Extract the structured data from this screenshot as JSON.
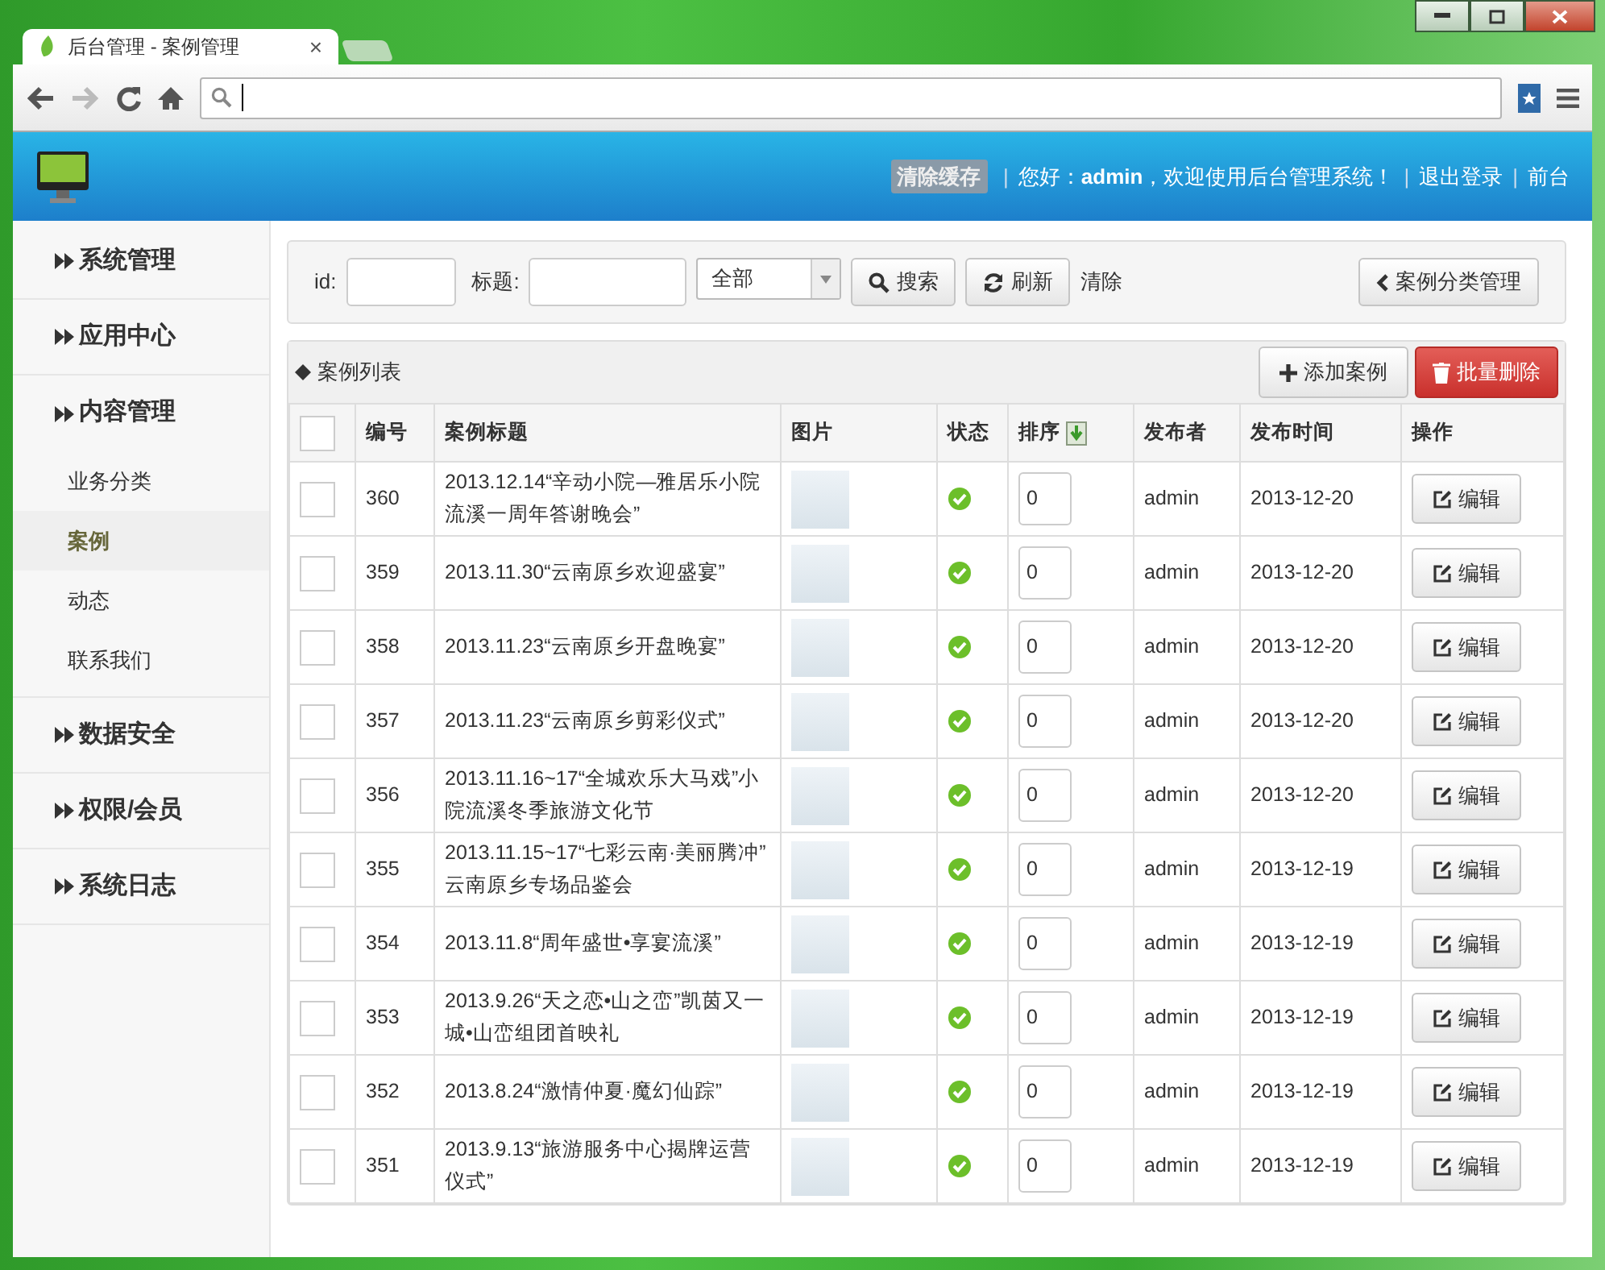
{
  "browser": {
    "tab_title": "后台管理 - 案例管理",
    "tab_close": "×"
  },
  "header": {
    "clear_cache": "清除缓存",
    "items": [
      {
        "separator": "|",
        "text": "您好：**admin**，欢迎使用后台管理系统！"
      },
      {
        "separator": "|",
        "text": "退出登录"
      },
      {
        "separator": "|",
        "text": "前台"
      }
    ]
  },
  "sidebar": {
    "groups": [
      {
        "label": "系统管理",
        "expanded": false
      },
      {
        "label": "应用中心",
        "expanded": false
      },
      {
        "label": "内容管理",
        "expanded": true,
        "children": [
          {
            "label": "业务分类",
            "selected": false
          },
          {
            "label": "案例",
            "selected": true
          },
          {
            "label": "动态",
            "selected": false
          },
          {
            "label": "联系我们",
            "selected": false
          }
        ]
      },
      {
        "label": "数据安全",
        "expanded": false
      },
      {
        "label": "权限/会员",
        "expanded": false
      },
      {
        "label": "系统日志",
        "expanded": false
      }
    ]
  },
  "filter": {
    "id_label": "id:",
    "title_label": "标题:",
    "select_value": "全部",
    "search": "搜索",
    "refresh": "刷新",
    "clear": "清除",
    "category_button": "案例分类管理"
  },
  "list": {
    "title": "案例列表",
    "add_button": "添加案例",
    "delete_button": "批量删除",
    "header_checked": false,
    "columns": [
      "编号",
      "案例标题",
      "图片",
      "状态",
      "排序",
      "发布者",
      "发布时间",
      "操作"
    ],
    "rows": [
      {
        "checked": false,
        "id": "360",
        "title": "2013.12.14“辛动小院—雅居乐小院流溪一周年答谢晚会”",
        "status_ok": true,
        "sort": "0",
        "publisher": "admin",
        "date": "2013-12-20",
        "action": "编辑"
      },
      {
        "checked": false,
        "id": "359",
        "title": "2013.11.30“云南原乡欢迎盛宴”",
        "status_ok": true,
        "sort": "0",
        "publisher": "admin",
        "date": "2013-12-20",
        "action": "编辑"
      },
      {
        "checked": false,
        "id": "358",
        "title": "2013.11.23“云南原乡开盘晚宴”",
        "status_ok": true,
        "sort": "0",
        "publisher": "admin",
        "date": "2013-12-20",
        "action": "编辑"
      },
      {
        "checked": false,
        "id": "357",
        "title": "2013.11.23“云南原乡剪彩仪式”",
        "status_ok": true,
        "sort": "0",
        "publisher": "admin",
        "date": "2013-12-20",
        "action": "编辑"
      },
      {
        "checked": false,
        "id": "356",
        "title": "2013.11.16~17“全城欢乐大马戏”小院流溪冬季旅游文化节",
        "status_ok": true,
        "sort": "0",
        "publisher": "admin",
        "date": "2013-12-20",
        "action": "编辑"
      },
      {
        "checked": false,
        "id": "355",
        "title": "2013.11.15~17“七彩云南·美丽腾冲” 云南原乡专场品鉴会",
        "status_ok": true,
        "sort": "0",
        "publisher": "admin",
        "date": "2013-12-19",
        "action": "编辑"
      },
      {
        "checked": false,
        "id": "354",
        "title": "2013.11.8“周年盛世•享宴流溪”",
        "status_ok": true,
        "sort": "0",
        "publisher": "admin",
        "date": "2013-12-19",
        "action": "编辑"
      },
      {
        "checked": false,
        "id": "353",
        "title": "2013.9.26“天之恋•山之峦”凯茵又一城•山峦组团首映礼",
        "status_ok": true,
        "sort": "0",
        "publisher": "admin",
        "date": "2013-12-19",
        "action": "编辑"
      },
      {
        "checked": false,
        "id": "352",
        "title": "2013.8.24“激情仲夏·魔幻仙踪”",
        "status_ok": true,
        "sort": "0",
        "publisher": "admin",
        "date": "2013-12-19",
        "action": "编辑"
      },
      {
        "checked": false,
        "id": "351",
        "title": "2013.9.13“旅游服务中心揭牌运营仪式”",
        "status_ok": true,
        "sort": "0",
        "publisher": "admin",
        "date": "2013-12-19",
        "action": "编辑"
      }
    ]
  }
}
